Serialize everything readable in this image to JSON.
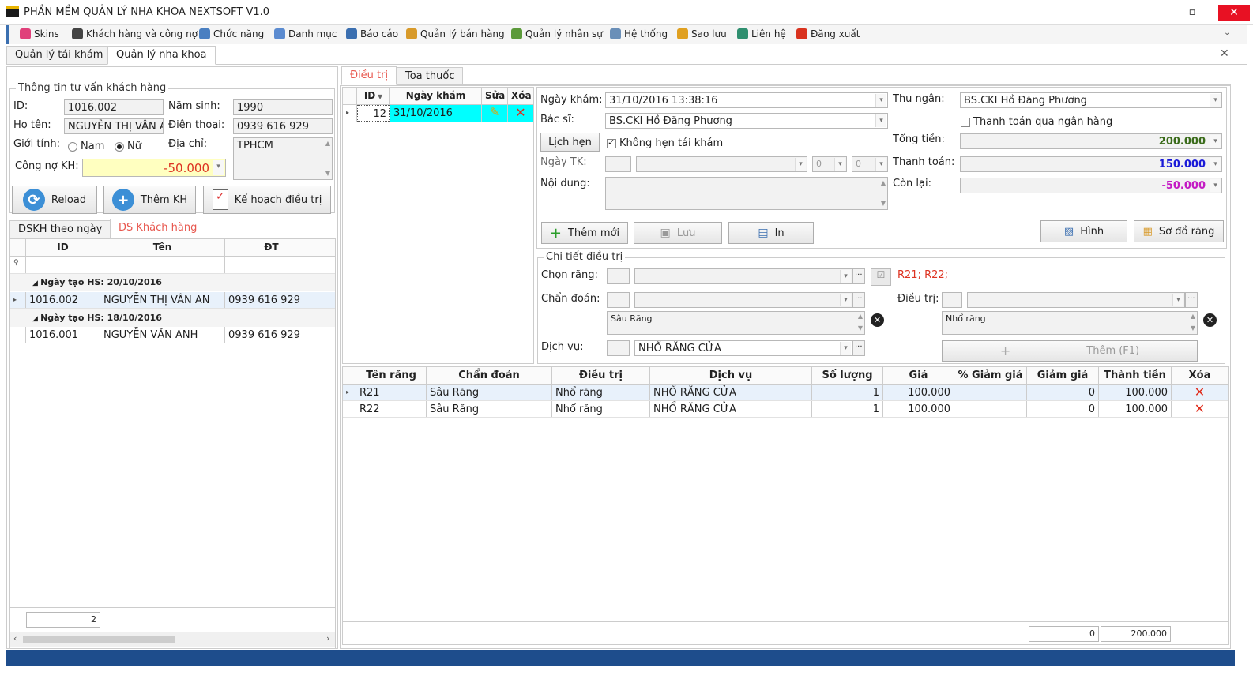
{
  "app": {
    "title": "PHẦN MỀM QUẢN LÝ NHA KHOA NEXTSOFT V1.0"
  },
  "menu": [
    {
      "label": "Skins",
      "icon": "palette-icon",
      "color": "#e0407a"
    },
    {
      "label": "Khách hàng và công nợ",
      "icon": "person-icon",
      "color": "#444"
    },
    {
      "label": "Chức năng",
      "icon": "monitor-icon",
      "color": "#4a7fc1"
    },
    {
      "label": "Danh mục",
      "icon": "list-icon",
      "color": "#5b8bd0"
    },
    {
      "label": "Báo cáo",
      "icon": "report-icon",
      "color": "#3b6fb0"
    },
    {
      "label": "Quản lý bán hàng",
      "icon": "box-icon",
      "color": "#d89a2a"
    },
    {
      "label": "Quản lý nhân sự",
      "icon": "people-icon",
      "color": "#5c9a3a"
    },
    {
      "label": "Hệ thống",
      "icon": "gears-icon",
      "color": "#6a8fb8"
    },
    {
      "label": "Sao lưu",
      "icon": "database-icon",
      "color": "#e0a020"
    },
    {
      "label": "Liên hệ",
      "icon": "contact-icon",
      "color": "#2f8f6f"
    },
    {
      "label": "Đăng xuất",
      "icon": "logout-icon",
      "color": "#d9321e"
    }
  ],
  "top_tabs": [
    "Quản lý tái khám",
    "Quản lý nha khoa"
  ],
  "customer": {
    "section_title": "Thông tin tư vấn khách hàng",
    "id_label": "ID:",
    "id": "1016.002",
    "birth_label": "Năm sinh:",
    "birth": "1990",
    "name_label": "Họ tên:",
    "name": "NGUYỄN THỊ VÂN AI",
    "phone_label": "Điện thoại:",
    "phone": "0939 616 929",
    "gender_label": "Giới tính:",
    "male": "Nam",
    "female": "Nữ",
    "address_label": "Địa chỉ:",
    "address": "TPHCM",
    "debt_label": "Công nợ KH:",
    "debt": "-50.000"
  },
  "left_buttons": {
    "reload": "Reload",
    "add": "Thêm KH",
    "plan": "Kế hoạch điều trị"
  },
  "left_tabs": [
    "DSKH theo ngày",
    "DS Khách hàng"
  ],
  "cust_grid": {
    "headers": [
      "ID",
      "Tên",
      "ĐT"
    ],
    "groups": [
      {
        "label": "Ngày tạo HS: 20/10/2016",
        "rows": [
          [
            "1016.002",
            "NGUYỄN THỊ VÂN AN",
            "0939 616 929"
          ]
        ]
      },
      {
        "label": "Ngày tạo HS: 18/10/2016",
        "rows": [
          [
            "1016.001",
            "NGUYỄN VĂN ANH",
            "0939 616 929"
          ]
        ]
      }
    ],
    "count": "2"
  },
  "right_tabs": [
    "Điều trị",
    "Toa thuốc"
  ],
  "visit_grid": {
    "headers": [
      "ID",
      "Ngày khám",
      "Sửa",
      "Xóa"
    ],
    "row": {
      "id": "12",
      "date": "31/10/2016"
    }
  },
  "visit": {
    "date_label": "Ngày khám:",
    "date": "31/10/2016 13:38:16",
    "doctor_label": "Bác sĩ:",
    "doctor": "BS.CKI Hồ Đăng Phương",
    "appt_button": "Lịch hẹn",
    "no_appt": "Không hẹn tái khám",
    "recheck_label": "Ngày TK:",
    "hour": "0",
    "minute": "0",
    "content_label": "Nội dung:",
    "cashier_label": "Thu ngân:",
    "cashier": "BS.CKI Hồ Đăng Phương",
    "bank_label": "Thanh toán qua ngân hàng",
    "total_label": "Tổng tiền:",
    "total": "200.000",
    "paid_label": "Thanh toán:",
    "paid": "150.000",
    "remain_label": "Còn lại:",
    "remain": "-50.000",
    "add_button": "Thêm mới",
    "save_button": "Lưu",
    "print_button": "In",
    "image_button": "Hình",
    "chart_button": "Sơ đồ răng"
  },
  "detail": {
    "section_title": "Chi tiết điều trị",
    "tooth_label": "Chọn răng:",
    "teeth_selected": "R21; R22;",
    "diag_label": "Chẩn đoán:",
    "diag_text": "Sâu Răng",
    "treat_label": "Điều trị:",
    "treat_text": "Nhổ răng",
    "service_label": "Dịch vụ:",
    "service": "NHỔ RĂNG CỬA",
    "add_button": "Thêm (F1)"
  },
  "treat_grid": {
    "headers": [
      "Tên răng",
      "Chẩn đoán",
      "Điều trị",
      "Dịch vụ",
      "Số lượng",
      "Giá",
      "% Giảm giá",
      "Giảm giá",
      "Thành tiền",
      "Xóa"
    ],
    "rows": [
      [
        "R21",
        "Sâu Răng",
        "Nhổ răng",
        "NHỔ RĂNG CỬA",
        "1",
        "100.000",
        "",
        "0",
        "100.000"
      ],
      [
        "R22",
        "Sâu Răng",
        "Nhổ răng",
        "NHỔ RĂNG CỬA",
        "1",
        "100.000",
        "",
        "0",
        "100.000"
      ]
    ],
    "footer_discount": "0",
    "footer_total": "200.000"
  },
  "colors": {
    "accent_tab": "#e8584f",
    "selected_row": "#00ffff",
    "debt_bg": "#ffffc0",
    "total": "#3a6b1a",
    "paid": "#1a1ad8",
    "remain": "#c41ac4",
    "status": "#1e4d8c"
  }
}
